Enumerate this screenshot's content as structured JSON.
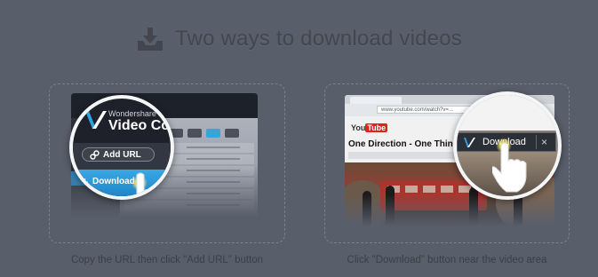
{
  "header": {
    "title": "Two ways to download videos",
    "icon": "download-tray-icon"
  },
  "left_card": {
    "caption": "Copy the URL then click \"Add URL\" button",
    "brand": "Wondershare",
    "product": "Video Co",
    "add_url_label": "Add URL",
    "download_label": "Download"
  },
  "right_card": {
    "caption": "Click \"Download\" button near the video area",
    "address": "www.youtube.com/watch?v=...",
    "youtube_logo_you": "You",
    "youtube_logo_tube": "Tube",
    "video_title": "One Direction - One Thing",
    "download_label": "Download",
    "close_label": "×"
  },
  "colors": {
    "background": "#595e6b",
    "accent": "#3aa8e6",
    "youtube_red": "#e62117"
  }
}
